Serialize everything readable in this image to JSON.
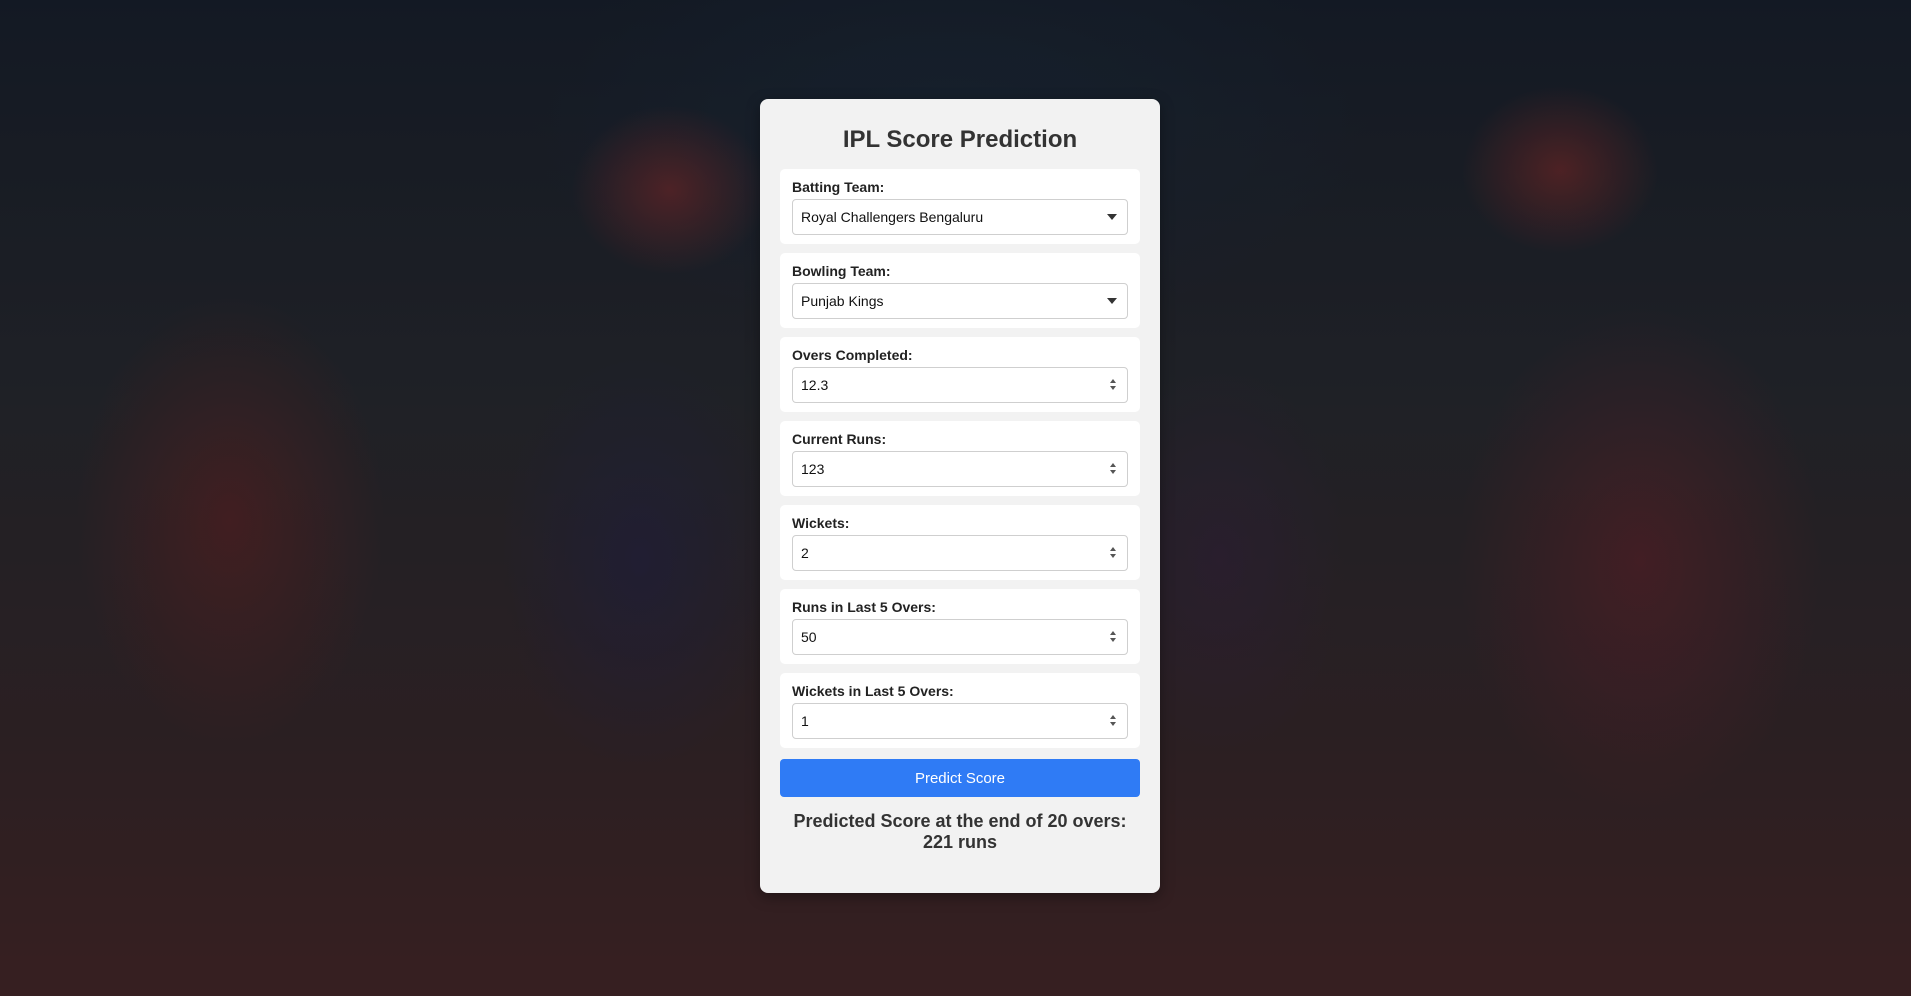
{
  "page": {
    "title": "IPL Score Prediction"
  },
  "form": {
    "batting_team": {
      "label": "Batting Team:",
      "value": "Royal Challengers Bengaluru"
    },
    "bowling_team": {
      "label": "Bowling Team:",
      "value": "Punjab Kings"
    },
    "overs_completed": {
      "label": "Overs Completed:",
      "value": "12.3"
    },
    "current_runs": {
      "label": "Current Runs:",
      "value": "123"
    },
    "wickets": {
      "label": "Wickets:",
      "value": "2"
    },
    "runs_last_5": {
      "label": "Runs in Last 5 Overs:",
      "value": "50"
    },
    "wickets_last_5": {
      "label": "Wickets in Last 5 Overs:",
      "value": "1"
    },
    "submit_label": "Predict Score"
  },
  "result": {
    "text": "Predicted Score at the end of 20 overs: 221 runs"
  },
  "colors": {
    "button": "#2f7bf5",
    "card": "#f2f2f2"
  },
  "icons": {
    "select": "chevron-down-icon",
    "number": "spinner-icon"
  }
}
